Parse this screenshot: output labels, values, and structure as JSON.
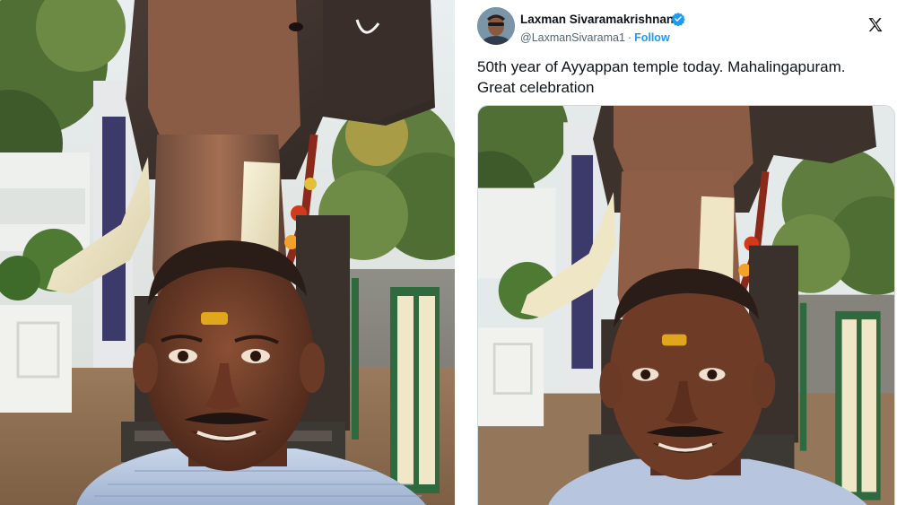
{
  "tweet": {
    "author_name": "Laxman Sivaramakrishnan",
    "handle": "@LaxmanSivarama1",
    "separator": "·",
    "follow_label": "Follow",
    "text_line1": "50th year of Ayyappan temple today. Mahalingapuram.",
    "text_line2": "Great celebration"
  },
  "icons": {
    "verified": "verified-badge-icon",
    "platform": "x-logo-icon"
  },
  "colors": {
    "accent": "#1d9bf0",
    "text_primary": "#0f1419",
    "text_secondary": "#536471"
  }
}
